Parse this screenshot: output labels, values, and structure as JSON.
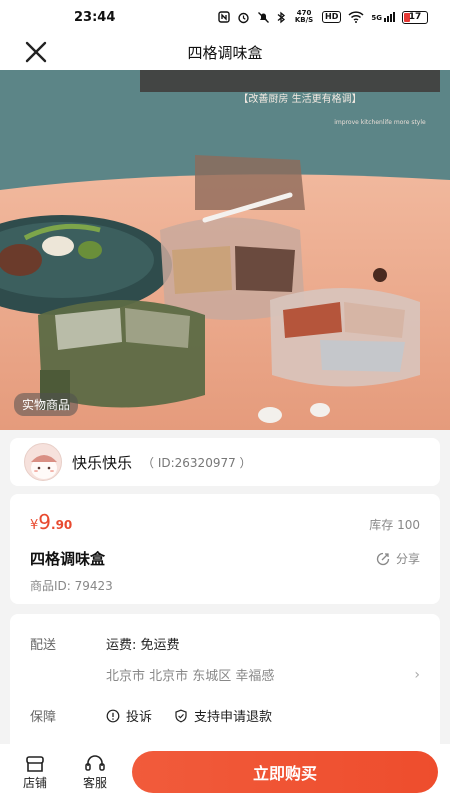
{
  "status_bar": {
    "time": "23:44",
    "network_speed": "470 KB/S",
    "hd_label": "HD",
    "signal_label": "5G",
    "battery": "17"
  },
  "nav": {
    "title": "四格调味盒"
  },
  "hero": {
    "badge": "实物商品",
    "banner_slogan": "【改善厨房 生活更有格调】",
    "banner_sub": "improve kitchenlife more style"
  },
  "shop": {
    "name": "快乐快乐",
    "id": "（ ID:26320977 ）"
  },
  "product": {
    "currency": "¥",
    "price_int": "9",
    "price_dec": ".90",
    "stock": "库存 100",
    "name": "四格调味盒",
    "share_label": "分享",
    "product_id": "商品ID:  79423"
  },
  "delivery": {
    "label": "配送",
    "shipping": "运费:  免运费",
    "address": "北京市 北京市 东城区 幸福感",
    "guarantee_label": "保障",
    "guarantee_items": [
      "投诉",
      "支持申请退款"
    ]
  },
  "bottom_bar": {
    "store": "店铺",
    "service": "客服",
    "buy": "立即购买"
  },
  "colors": {
    "accent": "#ee4d2d",
    "price": "#e84a2f"
  }
}
